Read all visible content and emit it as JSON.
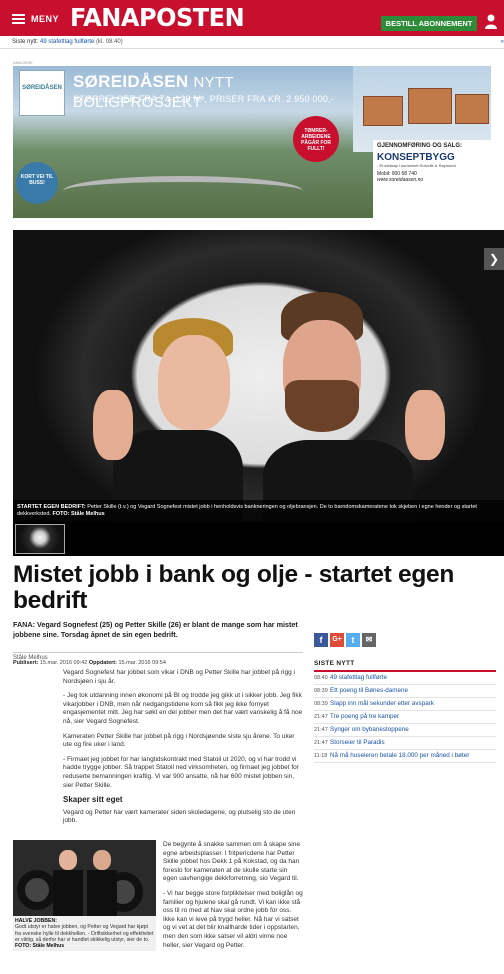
{
  "header": {
    "menu_label": "MENY",
    "logo": "FANAPOSTEN",
    "subscribe_label": "BESTILL ABONNEMENT",
    "brand_color": "#c8102e"
  },
  "newsbar": {
    "label": "Siste nytt:",
    "headline": "49 stafettlag fullførte",
    "time": "(kl. 08:40)",
    "arrow": "«"
  },
  "ad": {
    "label": "ANNONSE",
    "logo_text": "SØREIDÅSEN",
    "title": "SØREIDÅSEN",
    "title_suffix": "NYTT BOLIGPROSJEKT",
    "subtitle": "STØRRELSER FRA 74–126 M², PRISER FRA KR. 2 950 000,-",
    "badge_red": "TØMRER-ARBEIDENE PÅGÅR FOR FULLT!",
    "badge_blue": "KORT VEI TIL BUSS!",
    "info_label": "GJENNOMFØRING OG SALG:",
    "info_brand": "KONSEPTBYGG",
    "info_small": "- Et selskap i konsernet Solvelle & Raymond",
    "info_mobile": "Mobil: 900 68 740",
    "info_url": "www.soreidaasen.no"
  },
  "hero": {
    "caption_label": "STARTET EGEN BEDRIFT:",
    "caption_text": "Petter Skille (t.v.) og Vegard Sognefest mistet jobb i henholdsvis bankneringen og oljebransjen. De to barndomskameratene tok skjeben i egne hender og startet dekkverksted.",
    "caption_photo": "FOTO: Ståle Melhus",
    "next_arrow": "❯"
  },
  "article": {
    "title": "Mistet jobb i bank og olje - startet egen bedrift",
    "lead": "FANA: Vegard Sognefest (25) og Petter Skille (26) er blant de mange som har mistet jobbene sine. Torsdag åpnet de sin egen bedrift.",
    "author": "Ståle Melhus",
    "published_label": "Publisert:",
    "published": "15.mar. 2016 09:42",
    "updated_label": "Oppdatert:",
    "updated": "15.mar. 2016 09:54",
    "paragraphs": [
      "Vegard Sognefest har jobbet som vikar i DNB og Petter Skille har jobbet på rigg i Nordsjøen i sju år.",
      "- Jeg tok utdanning innen økonomi på BI og trodde jeg gikk ut i sikker jobb. Jeg fikk vikarjobber i DNB, men når nedgangstidene kom så fikk jeg ikke fornyet engasjementet mitt. Jeg har søkt en del jobber men det har vært vanskelig å få noe nå, sier Vegard Sognefest.",
      "Kameraten Petter Skille har jobbet på rigg i Nordsjøende siste sju årene. To uker ute og fire uker i land.",
      "- Firmaet jeg jobbet for har langtidskontrakt med Statoil ut 2020, og vi har trodd vi hadde trygge jobber. Så trappet Statoil ned virksomheten, og firmaet jeg jobbet for reduserte bemanningen kraftig. Vi var 900 ansatte, nå har 600 mistet jobben sin, sier Petter Skille."
    ],
    "subhead": "Skaper sitt eget",
    "paragraph_after_subhead": "Vegard og Petter har vært kamerater siden skoledagene, og plutselig sto de uten jobb.",
    "paragraphs_col2": [
      "De begynte å snakke sammen om å skape sine egne arbeidsplasser. I fritpericdene har Petter Skille jobbet hos Dekk 1 på Kokstad, og da han foreslo for kameraten at de skulle starte sin egen uavhengige dekkforretning, sio Vegard til.",
      "- Vi har begge store forpliktelser med boliglån og familier og hjulene skal gå rundt. Vi kan ikke stå oss til ro med at Nav skal ordne jobb for oss. Ikke kan vi leve på trygd heller. Nå har vi satset og vi vet at det blir knallharde tider i oppstarten, men den som ikke satser vil aldri vinne noe heller, sier Vegard og Petter."
    ],
    "photo2_label": "HALVE JOBBEN:",
    "photo2_text": "Godt utstyr er halve jobben, og Petter og Vegard har kjøpt fra svenske hylle til dekkhellen. - Driftsikkerhet og effektivitet er viktig, så derfor har vi handlet skikkelig utstyr, sier de to.",
    "photo2_photo": "FOTO: Ståle Melhus"
  },
  "share": {
    "facebook": "f",
    "google": "G+",
    "twitter": "t",
    "email": "✉",
    "colors": {
      "facebook": "#3b5998",
      "google": "#dd4b39",
      "twitter": "#55acee",
      "email": "#666666"
    }
  },
  "sidebar": {
    "heading": "SISTE NYTT",
    "items": [
      {
        "time": "08:40",
        "title": "49 stafettlag fullførte"
      },
      {
        "time": "08:39",
        "title": "Ett poeng til Bønes-damene"
      },
      {
        "time": "08:39",
        "title": "Slapp inn mål sekunder etter avspark"
      },
      {
        "time": "21:47",
        "title": "Tre poeng på tre kamper"
      },
      {
        "time": "21:47",
        "title": "Synger om bybanestoppene"
      },
      {
        "time": "21:47",
        "title": "Storseier til Paradis"
      },
      {
        "time": "11:18",
        "title": "Nå må huseieren betale 18.000 per måned i bøter"
      }
    ]
  }
}
